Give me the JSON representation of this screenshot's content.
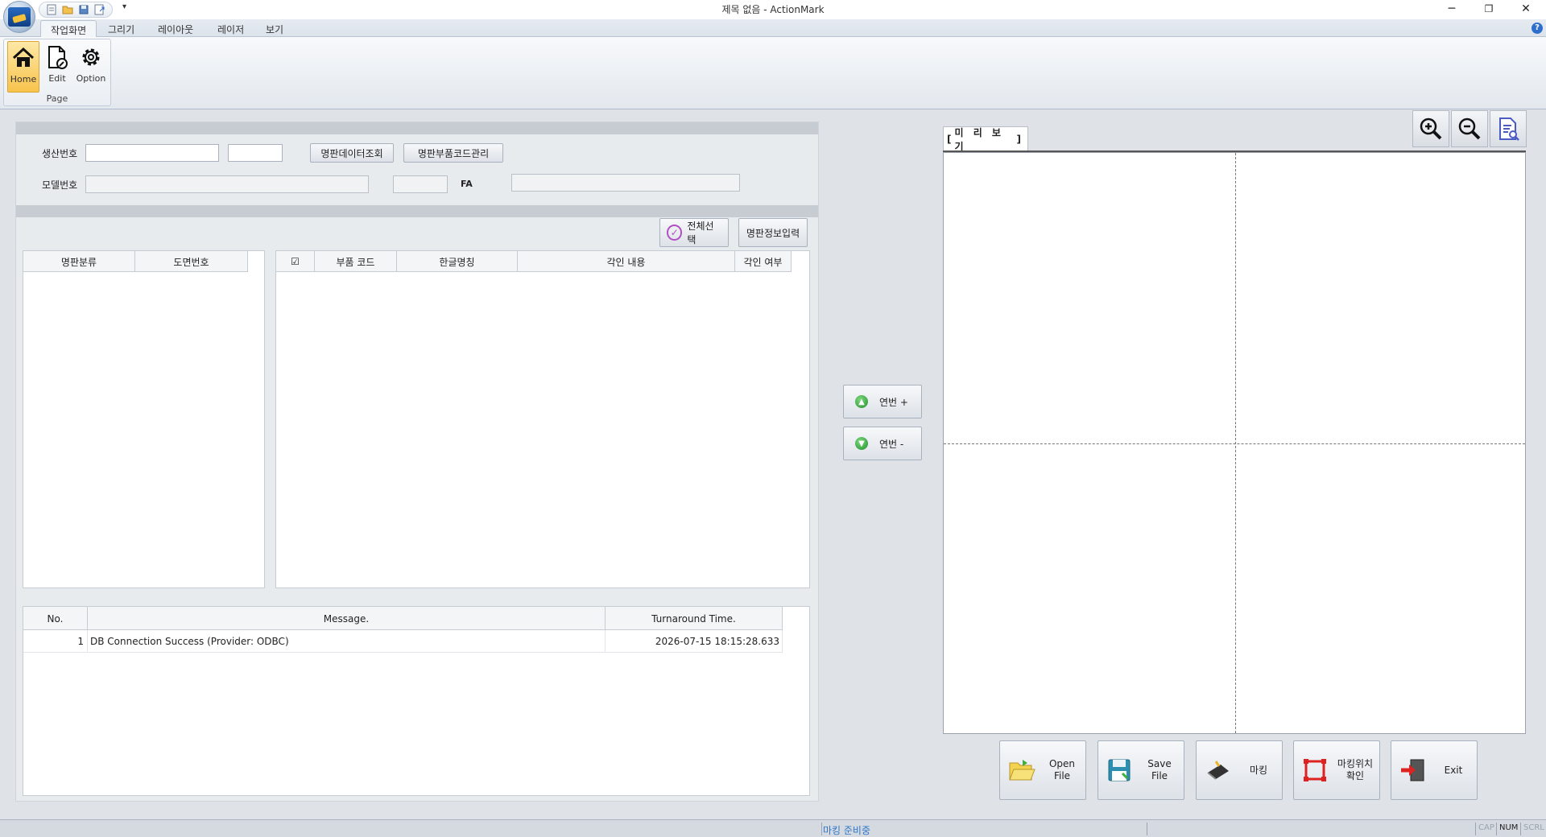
{
  "window": {
    "title": "제목 없음 - ActionMark"
  },
  "ribbon": {
    "tabs": [
      "작업화면",
      "그리기",
      "레이아웃",
      "레이저",
      "보기"
    ],
    "active_tab": "작업화면",
    "group_label": "Page",
    "buttons": [
      {
        "label": "Home",
        "icon": "home-icon",
        "active": true
      },
      {
        "label": "Edit",
        "icon": "edit-document-icon",
        "active": false
      },
      {
        "label": "Option",
        "icon": "gear-icon",
        "active": false
      }
    ]
  },
  "form": {
    "production_no_label": "생산번호",
    "production_no_value": "",
    "production_no_value2": "",
    "model_no_label": "모델번호",
    "model_no_value": "",
    "model_no_value2": "",
    "fa_label": "FA",
    "fa_value": "",
    "btn_nameplate_lookup": "명판데이터조회",
    "btn_part_code_mgmt": "명판부품코드관리"
  },
  "toolbar": {
    "select_all": "전체선택",
    "nameplate_input": "명판정보입력"
  },
  "category_grid": {
    "columns": [
      "명판분류",
      "도면번호"
    ]
  },
  "parts_grid": {
    "columns": [
      "☑",
      "부품 코드",
      "한글명칭",
      "각인 내용",
      "각인 여부"
    ]
  },
  "log_grid": {
    "columns": [
      "No.",
      "Message.",
      "Turnaround Time."
    ],
    "rows": [
      {
        "no": "1",
        "message": "DB Connection Success (Provider: ODBC)",
        "time": "2026-07-15 18:15:28.633"
      }
    ]
  },
  "serial": {
    "plus": "연번 +",
    "minus": "연번 -"
  },
  "preview": {
    "tab_label": "[ 미 리 보 기 ]",
    "bracket_open": "[",
    "bracket_close": "]",
    "title": "미 리 보 기"
  },
  "actions": [
    {
      "label": "Open File",
      "line1": "Open",
      "line2": "File",
      "icon": "folder-open-icon"
    },
    {
      "label": "Save File",
      "line1": "Save",
      "line2": "File",
      "icon": "save-disk-icon"
    },
    {
      "label": "마킹",
      "line1": "마킹",
      "line2": "",
      "icon": "laser-marker-icon"
    },
    {
      "label": "마킹위치 확인",
      "line1": "마킹위치",
      "line2": "확인",
      "icon": "marking-area-icon"
    },
    {
      "label": "Exit",
      "line1": "Exit",
      "line2": "",
      "icon": "exit-door-icon"
    }
  ],
  "status": {
    "message": "마킹 준비중",
    "indicators": [
      {
        "label": "CAP",
        "on": false
      },
      {
        "label": "NUM",
        "on": true
      },
      {
        "label": "SCRL",
        "on": false
      }
    ]
  },
  "colors": {
    "status_text": "#2e75c9",
    "active_ribbon_button": "#f8c34c"
  }
}
